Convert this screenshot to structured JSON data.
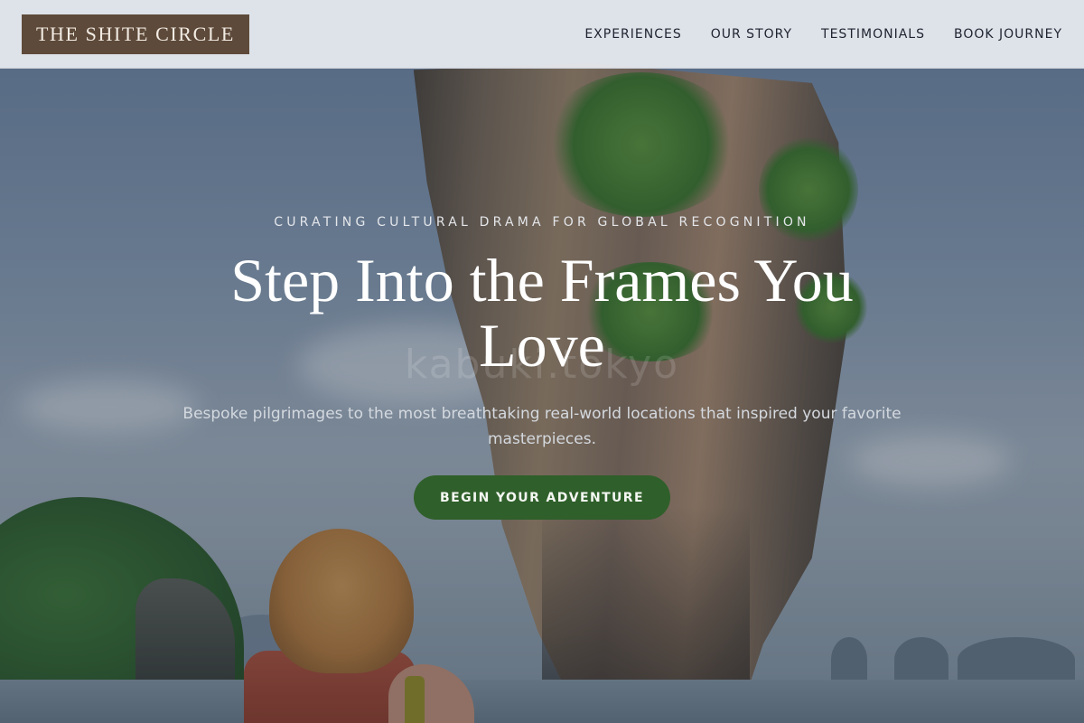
{
  "brand": {
    "logo_text": "THE SHITE CIRCLE"
  },
  "nav": {
    "items": [
      {
        "label": "EXPERIENCES"
      },
      {
        "label": "OUR STORY"
      },
      {
        "label": "TESTIMONIALS"
      },
      {
        "label": "BOOK JOURNEY"
      }
    ]
  },
  "hero": {
    "eyebrow": "CURATING CULTURAL DRAMA FOR GLOBAL RECOGNITION",
    "headline": "Step Into the Frames You Love",
    "subtitle": "Bespoke pilgrimages to the most breathtaking real-world locations that inspired your favorite masterpieces.",
    "cta_label": "BEGIN YOUR ADVENTURE",
    "watermark": "kabuki.tokyo"
  },
  "colors": {
    "logo_bg": "#5e4a3a",
    "cta_bg": "#2f5f2a",
    "nav_bg": "#e7eaef"
  }
}
